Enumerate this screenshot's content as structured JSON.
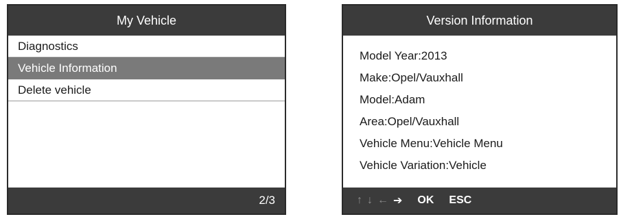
{
  "left_screen": {
    "title": "My Vehicle",
    "menu": [
      {
        "label": "Diagnostics",
        "selected": false
      },
      {
        "label": "Vehicle Information",
        "selected": true
      },
      {
        "label": "Delete vehicle",
        "selected": false
      }
    ],
    "page_indicator": "2/3"
  },
  "right_screen": {
    "title": "Version Information",
    "info_lines": [
      "Model Year:2013",
      "Make:Opel/Vauxhall",
      "Model:Adam",
      "Area:Opel/Vauxhall",
      "Vehicle Menu:Vehicle Menu",
      "Vehicle Variation:Vehicle"
    ],
    "footer": {
      "arrows": {
        "up": "↑",
        "down": "↓",
        "left": "←",
        "right": "➔"
      },
      "ok_label": "OK",
      "esc_label": "ESC"
    }
  },
  "colors": {
    "title_bar": "#3b3b3b",
    "selected_row": "#7a7a7a",
    "text": "#1a1a1a"
  }
}
